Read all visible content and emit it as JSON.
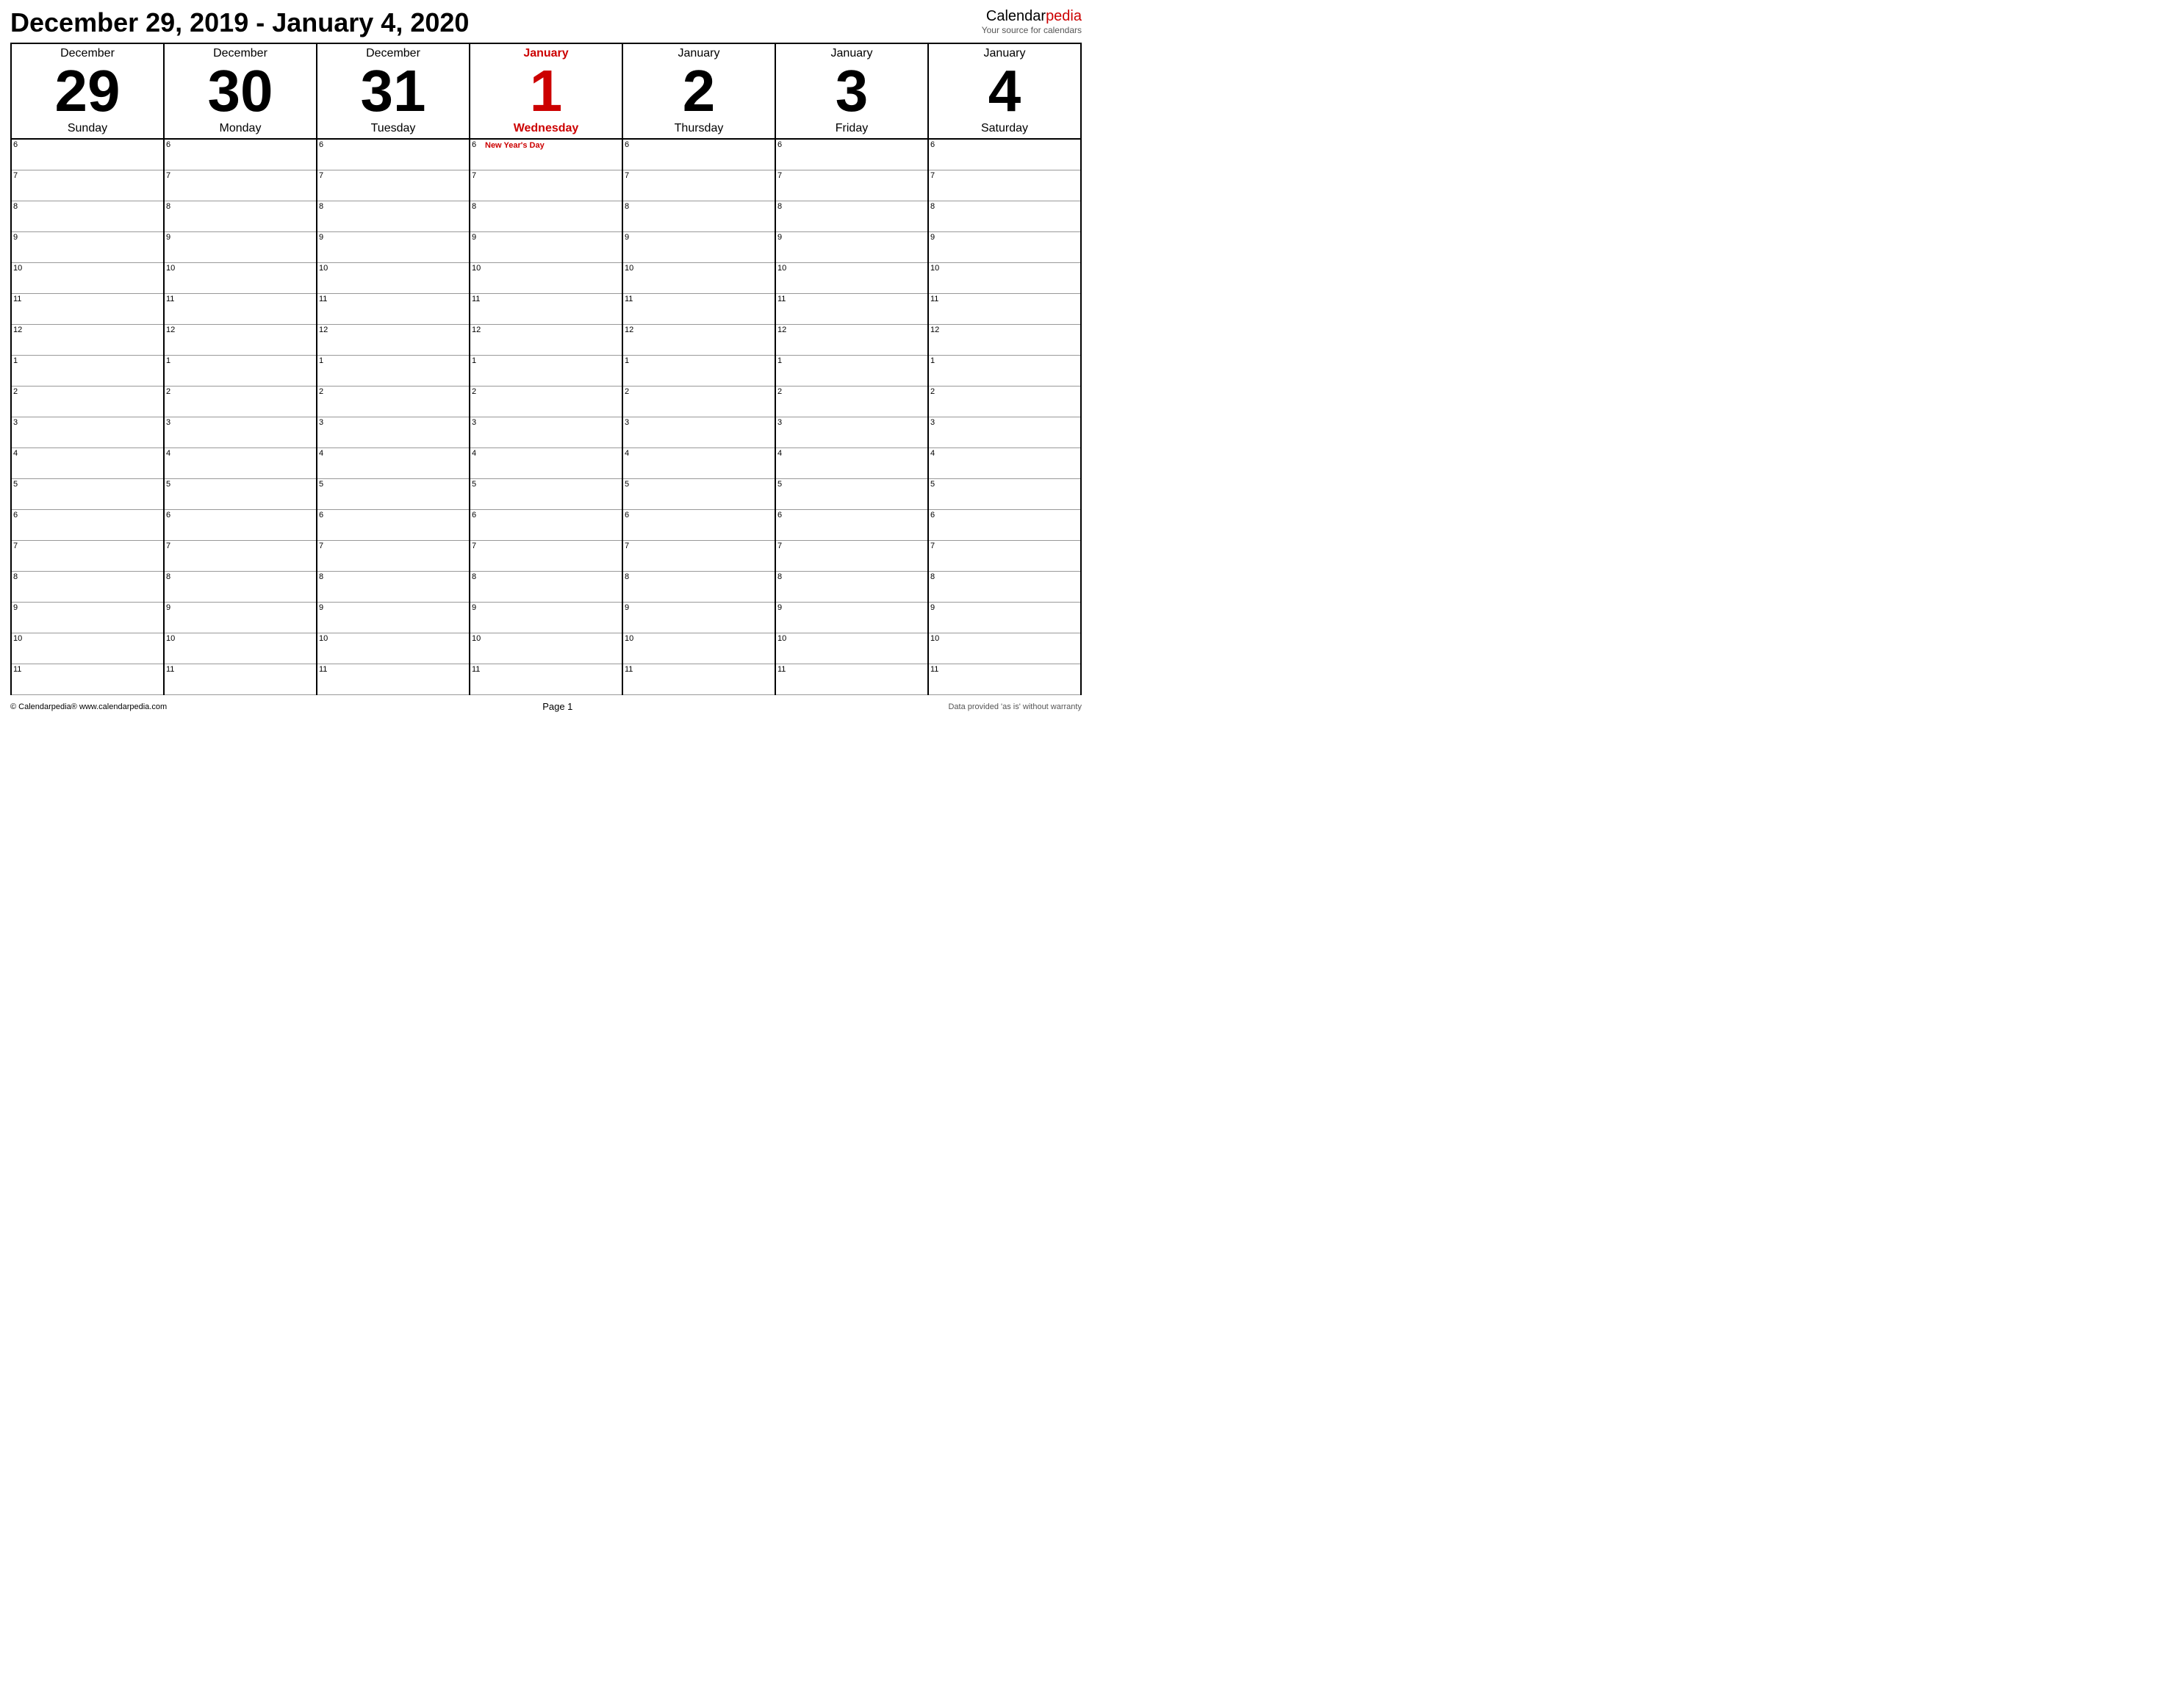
{
  "header": {
    "title": "December 29, 2019 - January 4, 2020",
    "brand_name": "Calendar",
    "brand_name_pedia": "pedia",
    "brand_tagline": "Your source for calendars"
  },
  "days": [
    {
      "month": "December",
      "number": "29",
      "name": "Sunday",
      "highlight": false
    },
    {
      "month": "December",
      "number": "30",
      "name": "Monday",
      "highlight": false
    },
    {
      "month": "December",
      "number": "31",
      "name": "Tuesday",
      "highlight": false
    },
    {
      "month": "January",
      "number": "1",
      "name": "Wednesday",
      "highlight": true
    },
    {
      "month": "January",
      "number": "2",
      "name": "Thursday",
      "highlight": false
    },
    {
      "month": "January",
      "number": "3",
      "name": "Friday",
      "highlight": false
    },
    {
      "month": "January",
      "number": "4",
      "name": "Saturday",
      "highlight": false
    }
  ],
  "time_slots": [
    "6",
    "7",
    "8",
    "9",
    "10",
    "11",
    "12",
    "1",
    "2",
    "3",
    "4",
    "5",
    "6",
    "7",
    "8",
    "9",
    "10",
    "11"
  ],
  "event": {
    "day_index": 3,
    "slot_index": 0,
    "text": "New Year's Day"
  },
  "footer": {
    "copyright": "© Calendarpedia®   www.calendarpedia.com",
    "page": "Page 1",
    "disclaimer": "Data provided 'as is' without warranty"
  }
}
